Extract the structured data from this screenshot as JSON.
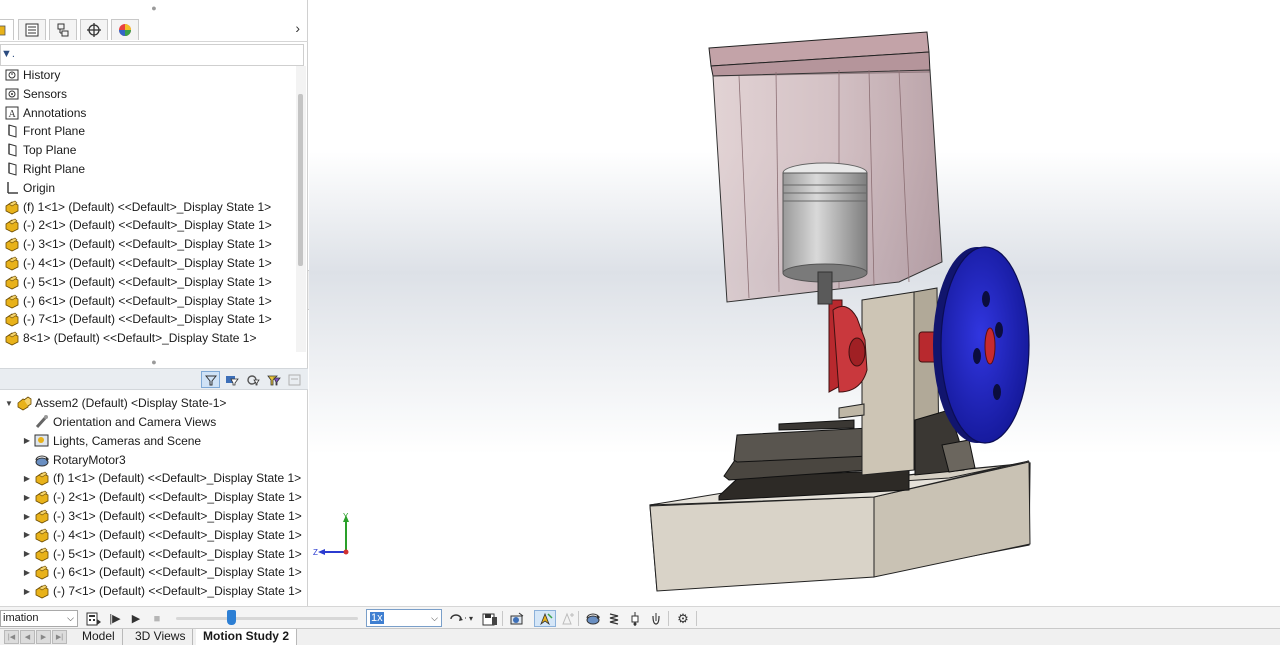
{
  "feature_tree": {
    "items": [
      {
        "label": "History",
        "icon": "history-icon"
      },
      {
        "label": "Sensors",
        "icon": "sensors-icon"
      },
      {
        "label": "Annotations",
        "icon": "annotations-icon"
      },
      {
        "label": "Front Plane",
        "icon": "plane-icon"
      },
      {
        "label": "Top Plane",
        "icon": "plane-icon"
      },
      {
        "label": "Right Plane",
        "icon": "plane-icon"
      },
      {
        "label": "Origin",
        "icon": "origin-icon"
      },
      {
        "label": "(f) 1<1> (Default) <<Default>_Display State 1>",
        "icon": "part-icon"
      },
      {
        "label": "(-) 2<1> (Default) <<Default>_Display State 1>",
        "icon": "part-icon"
      },
      {
        "label": "(-) 3<1> (Default) <<Default>_Display State 1>",
        "icon": "part-icon"
      },
      {
        "label": "(-) 4<1> (Default) <<Default>_Display State 1>",
        "icon": "part-icon"
      },
      {
        "label": "(-) 5<1> (Default) <<Default>_Display State 1>",
        "icon": "part-icon"
      },
      {
        "label": "(-) 6<1> (Default) <<Default>_Display State 1>",
        "icon": "part-icon"
      },
      {
        "label": "(-) 7<1> (Default) <<Default>_Display State 1>",
        "icon": "part-icon"
      },
      {
        "label": "8<1> (Default) <<Default>_Display State 1>",
        "icon": "part-icon"
      }
    ]
  },
  "motion_tree": {
    "root": "Assem2 (Default) <Display State-1>",
    "items": [
      {
        "label": "Orientation and Camera Views",
        "icon": "camera-views-icon",
        "expandable": false
      },
      {
        "label": "Lights, Cameras and Scene",
        "icon": "lights-icon",
        "expandable": true
      },
      {
        "label": "RotaryMotor3",
        "icon": "rotary-motor-icon",
        "expandable": false
      },
      {
        "label": "(f) 1<1> (Default) <<Default>_Display State 1>",
        "icon": "part-icon",
        "expandable": true
      },
      {
        "label": "(-) 2<1> (Default) <<Default>_Display State 1>",
        "icon": "part-icon",
        "expandable": true
      },
      {
        "label": "(-) 3<1> (Default) <<Default>_Display State 1>",
        "icon": "part-icon",
        "expandable": true
      },
      {
        "label": "(-) 4<1> (Default) <<Default>_Display State 1>",
        "icon": "part-icon",
        "expandable": true
      },
      {
        "label": "(-) 5<1> (Default) <<Default>_Display State 1>",
        "icon": "part-icon",
        "expandable": true
      },
      {
        "label": "(-) 6<1> (Default) <<Default>_Display State 1>",
        "icon": "part-icon",
        "expandable": true
      },
      {
        "label": "(-) 7<1> (Default) <<Default>_Display State 1>",
        "icon": "part-icon",
        "expandable": true
      }
    ]
  },
  "motion_toolbar": {
    "study_type": "imation",
    "playback_speed": "1x",
    "slider_position": 0.3
  },
  "triad": {
    "y": "Y",
    "z": "Z"
  },
  "bottom_tabs": [
    {
      "label": "Model",
      "active": false
    },
    {
      "label": "3D Views",
      "active": false
    },
    {
      "label": "Motion Study 2",
      "active": true
    }
  ],
  "colors": {
    "accent": "#3f7fd1",
    "flywheel": "#1f23c8",
    "crank": "#b8292e",
    "cylinder": "#b89aa0",
    "base": "#d8d2c6",
    "part_icon": "#e8b21a"
  }
}
